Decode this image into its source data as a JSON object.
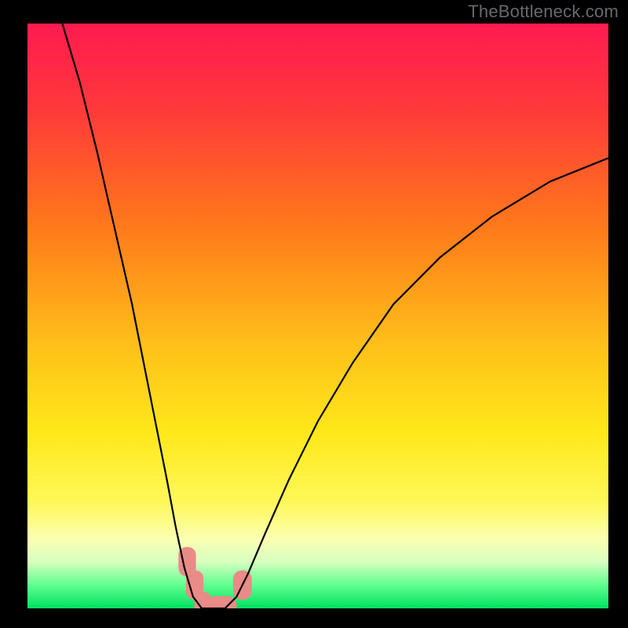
{
  "watermark": "TheBottleneck.com",
  "chart_data": {
    "type": "line",
    "title": "",
    "xlabel": "",
    "ylabel": "",
    "xlim": [
      0,
      100
    ],
    "ylim": [
      0,
      100
    ],
    "background_gradient": {
      "stops": [
        {
          "offset": 0,
          "color": "#ff1a50"
        },
        {
          "offset": 15,
          "color": "#ff3a3a"
        },
        {
          "offset": 35,
          "color": "#ff7a1a"
        },
        {
          "offset": 55,
          "color": "#ffc01a"
        },
        {
          "offset": 70,
          "color": "#ffe81a"
        },
        {
          "offset": 82,
          "color": "#fff85a"
        },
        {
          "offset": 88,
          "color": "#fcffb0"
        },
        {
          "offset": 92,
          "color": "#d8ffc0"
        },
        {
          "offset": 96,
          "color": "#60ff90"
        },
        {
          "offset": 100,
          "color": "#00e060"
        }
      ]
    },
    "series": [
      {
        "name": "bottleneck-curve",
        "comment": "V-shaped curve; left branch steep, right branch shallower. x in 0..100, y is percent height (0=bottom,100=top).",
        "points": [
          {
            "x": 6,
            "y": 100
          },
          {
            "x": 9,
            "y": 90
          },
          {
            "x": 12,
            "y": 78
          },
          {
            "x": 15,
            "y": 65
          },
          {
            "x": 18,
            "y": 52
          },
          {
            "x": 20,
            "y": 42
          },
          {
            "x": 22,
            "y": 32
          },
          {
            "x": 24,
            "y": 22
          },
          {
            "x": 25.5,
            "y": 14
          },
          {
            "x": 27,
            "y": 7
          },
          {
            "x": 28.5,
            "y": 2
          },
          {
            "x": 30,
            "y": 0
          },
          {
            "x": 32,
            "y": 0
          },
          {
            "x": 34,
            "y": 0
          },
          {
            "x": 36,
            "y": 2
          },
          {
            "x": 38,
            "y": 6
          },
          {
            "x": 41,
            "y": 13
          },
          {
            "x": 45,
            "y": 22
          },
          {
            "x": 50,
            "y": 32
          },
          {
            "x": 56,
            "y": 42
          },
          {
            "x": 63,
            "y": 52
          },
          {
            "x": 71,
            "y": 60
          },
          {
            "x": 80,
            "y": 67
          },
          {
            "x": 90,
            "y": 73
          },
          {
            "x": 100,
            "y": 77
          }
        ]
      }
    ],
    "markers": [
      {
        "name": "marker",
        "x": 27.5,
        "y": 8,
        "w": 3.0,
        "h": 5.0,
        "color": "#e98b87"
      },
      {
        "name": "marker",
        "x": 28.8,
        "y": 4,
        "w": 3.0,
        "h": 5.0,
        "color": "#e98b87"
      },
      {
        "name": "marker",
        "x": 30.2,
        "y": 0.8,
        "w": 3.0,
        "h": 4.0,
        "color": "#e98b87"
      },
      {
        "name": "marker",
        "x": 33.5,
        "y": 0.5,
        "w": 5.0,
        "h": 3.2,
        "color": "#e98b87"
      },
      {
        "name": "marker",
        "x": 37.0,
        "y": 4,
        "w": 3.2,
        "h": 5.0,
        "color": "#e98b87"
      }
    ]
  }
}
